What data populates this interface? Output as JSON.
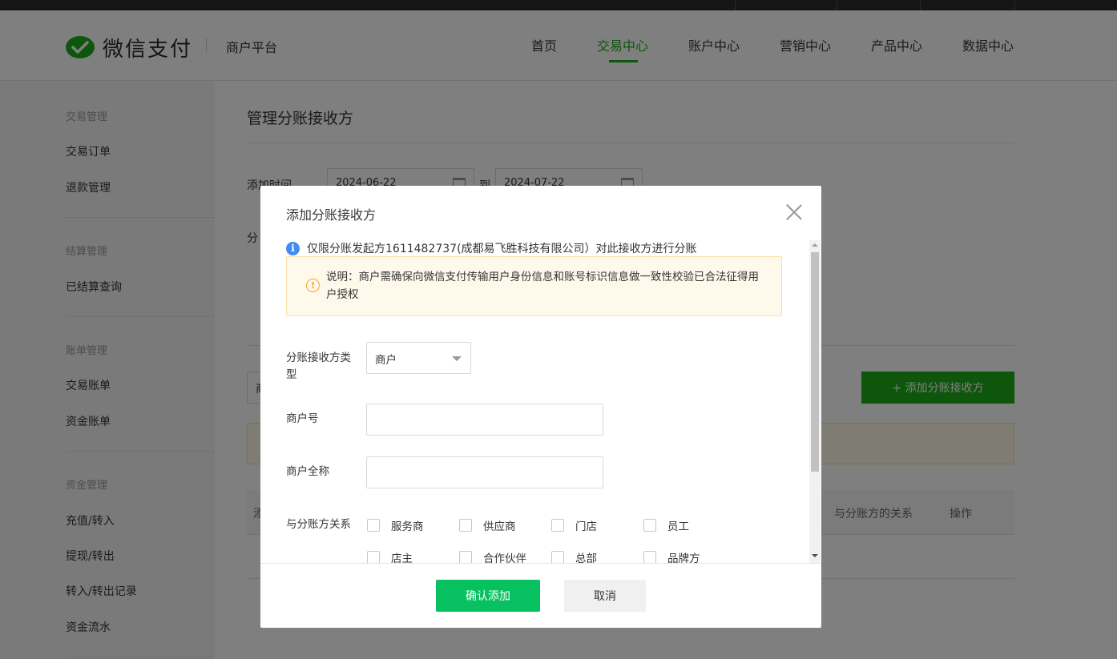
{
  "brand": {
    "name": "微信支付",
    "platform": "商户平台",
    "color": "#1aad19"
  },
  "nav": {
    "items": [
      "首页",
      "交易中心",
      "账户中心",
      "营销中心",
      "产品中心",
      "数据中心"
    ],
    "active": "交易中心"
  },
  "sidebar": {
    "groups": [
      {
        "heading": "交易管理",
        "items": [
          "交易订单",
          "退款管理"
        ]
      },
      {
        "heading": "结算管理",
        "items": [
          "已结算查询"
        ]
      },
      {
        "heading": "账单管理",
        "items": [
          "交易账单",
          "资金账单"
        ]
      },
      {
        "heading": "资金管理",
        "items": [
          "充值/转入",
          "提现/转出",
          "转入/转出记录",
          "资金流水"
        ]
      }
    ]
  },
  "page": {
    "title": "管理分账接收方",
    "filter": {
      "label": "添加时间",
      "start": "2024-06-22",
      "to": "到",
      "end": "2024-07-22",
      "label2_partial": "分",
      "input_partial": "商"
    },
    "add_button": "+ 添加分账接收方",
    "table_headers": {
      "col_first_partial": "添",
      "relation": "与分账方的关系",
      "action": "操作"
    }
  },
  "dialog": {
    "title": "添加分账接收方",
    "info": "仅限分账发起方1611482737(成都易飞胜科技有限公司）对此接收方进行分账",
    "notice": "说明：商户需确保向微信支付传输用户身份信息和账号标识信息做一致性校验已合法征得用户授权",
    "fields": {
      "type_label": "分账接收方类型",
      "type_value": "商户",
      "merchant_no_label": "商户号",
      "merchant_no_value": "",
      "merchant_name_label": "商户全称",
      "merchant_name_value": "",
      "relation_label": "与分账方关系"
    },
    "relations": [
      "服务商",
      "供应商",
      "门店",
      "员工",
      "店主",
      "合作伙伴",
      "总部",
      "品牌方"
    ],
    "confirm": "确认添加",
    "cancel": "取消"
  }
}
